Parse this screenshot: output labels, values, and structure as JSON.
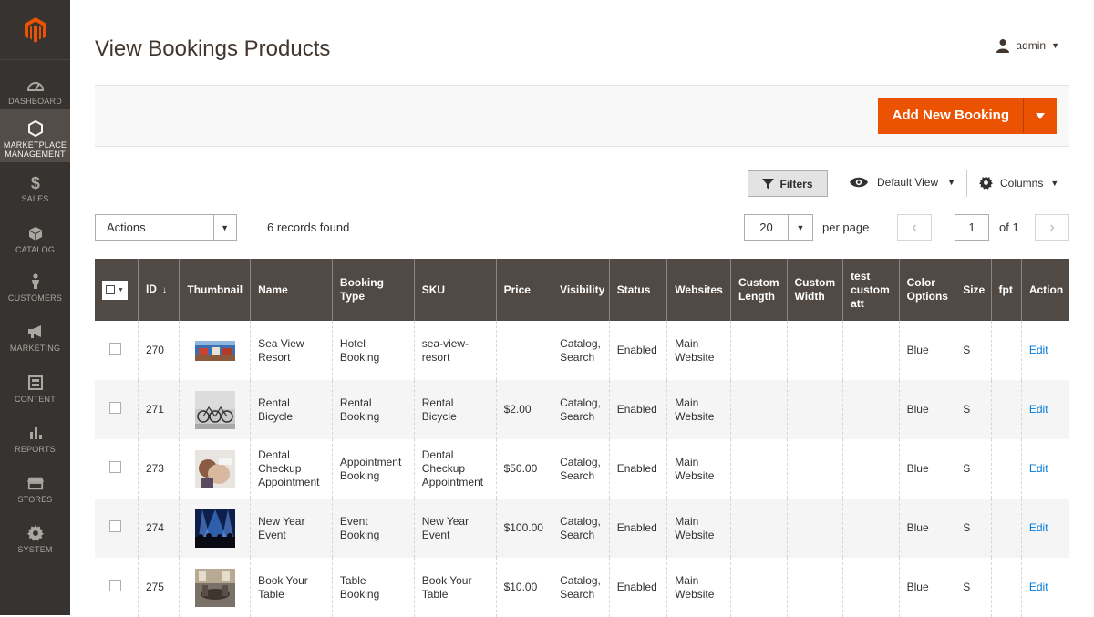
{
  "sidebar": {
    "items": [
      {
        "label": "DASHBOARD",
        "icon": "dashboard-icon"
      },
      {
        "label": "MARKETPLACE MANAGEMENT",
        "icon": "hexagon-icon",
        "active": true
      },
      {
        "label": "SALES",
        "icon": "dollar-icon"
      },
      {
        "label": "CATALOG",
        "icon": "cube-icon"
      },
      {
        "label": "CUSTOMERS",
        "icon": "person-icon"
      },
      {
        "label": "MARKETING",
        "icon": "megaphone-icon"
      },
      {
        "label": "CONTENT",
        "icon": "layout-icon"
      },
      {
        "label": "REPORTS",
        "icon": "bar-chart-icon"
      },
      {
        "label": "STORES",
        "icon": "store-icon"
      },
      {
        "label": "SYSTEM",
        "icon": "gear-icon"
      }
    ]
  },
  "header": {
    "title": "View Bookings Products",
    "user": "admin"
  },
  "page_actions": {
    "add_label": "Add New Booking"
  },
  "toolbar": {
    "filters_label": "Filters",
    "view_label": "Default View",
    "columns_label": "Columns",
    "actions_label": "Actions",
    "records_found": "6 records found",
    "per_page_value": "20",
    "per_page_label": "per page",
    "current_page": "1",
    "total_pages_label": "of 1"
  },
  "grid": {
    "columns": [
      "ID",
      "Thumbnail",
      "Name",
      "Booking Type",
      "SKU",
      "Price",
      "Visibility",
      "Status",
      "Websites",
      "Custom Length",
      "Custom Width",
      "test custom att",
      "Color Options",
      "Size",
      "fpt",
      "Action"
    ],
    "rows": [
      {
        "id": "270",
        "name": "Sea View Resort",
        "booking_type": "Hotel Booking",
        "sku": "sea-view-resort",
        "price": "",
        "visibility": "Catalog, Search",
        "status": "Enabled",
        "websites": "Main Website",
        "custom_length": "",
        "custom_width": "",
        "test_custom_att": "",
        "color": "Blue",
        "size": "S",
        "fpt": "",
        "action": "Edit",
        "thumb": "resort"
      },
      {
        "id": "271",
        "name": "Rental Bicycle",
        "booking_type": "Rental Booking",
        "sku": "Rental Bicycle",
        "price": "$2.00",
        "visibility": "Catalog, Search",
        "status": "Enabled",
        "websites": "Main Website",
        "custom_length": "",
        "custom_width": "",
        "test_custom_att": "",
        "color": "Blue",
        "size": "S",
        "fpt": "",
        "action": "Edit",
        "thumb": "bicycle"
      },
      {
        "id": "273",
        "name": "Dental Checkup Appointment",
        "booking_type": "Appointment Booking",
        "sku": "Dental Checkup Appointment",
        "price": "$50.00",
        "visibility": "Catalog, Search",
        "status": "Enabled",
        "websites": "Main Website",
        "custom_length": "",
        "custom_width": "",
        "test_custom_att": "",
        "color": "Blue",
        "size": "S",
        "fpt": "",
        "action": "Edit",
        "thumb": "dental"
      },
      {
        "id": "274",
        "name": "New Year Event",
        "booking_type": "Event Booking",
        "sku": "New Year Event",
        "price": "$100.00",
        "visibility": "Catalog, Search",
        "status": "Enabled",
        "websites": "Main Website",
        "custom_length": "",
        "custom_width": "",
        "test_custom_att": "",
        "color": "Blue",
        "size": "S",
        "fpt": "",
        "action": "Edit",
        "thumb": "concert"
      },
      {
        "id": "275",
        "name": "Book Your Table",
        "booking_type": "Table Booking",
        "sku": "Book Your Table",
        "price": "$10.00",
        "visibility": "Catalog, Search",
        "status": "Enabled",
        "websites": "Main Website",
        "custom_length": "",
        "custom_width": "",
        "test_custom_att": "",
        "color": "Blue",
        "size": "S",
        "fpt": "",
        "action": "Edit",
        "thumb": "table"
      }
    ]
  },
  "colors": {
    "sidebar_bg": "#373330",
    "accent": "#eb5202",
    "grid_header": "#514943",
    "link": "#007bdb"
  }
}
